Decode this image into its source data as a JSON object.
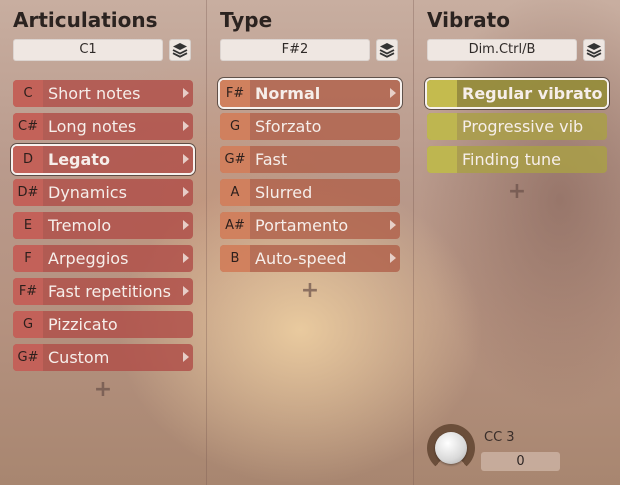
{
  "articulations": {
    "title": "Articulations",
    "selector_value": "C1",
    "items": [
      {
        "key": "C",
        "label": "Short notes",
        "has_arrow": true
      },
      {
        "key": "C#",
        "label": "Long notes",
        "has_arrow": true
      },
      {
        "key": "D",
        "label": "Legato",
        "has_arrow": true,
        "selected": true
      },
      {
        "key": "D#",
        "label": "Dynamics",
        "has_arrow": true
      },
      {
        "key": "E",
        "label": "Tremolo",
        "has_arrow": true
      },
      {
        "key": "F",
        "label": "Arpeggios",
        "has_arrow": true
      },
      {
        "key": "F#",
        "label": "Fast repetitions",
        "has_arrow": true
      },
      {
        "key": "G",
        "label": "Pizzicato",
        "has_arrow": false
      },
      {
        "key": "G#",
        "label": "Custom",
        "has_arrow": true
      }
    ],
    "add_label": "+"
  },
  "type": {
    "title": "Type",
    "selector_value": "F#2",
    "items": [
      {
        "key": "F#",
        "label": "Normal",
        "has_arrow": true,
        "selected": true
      },
      {
        "key": "G",
        "label": "Sforzato",
        "has_arrow": false
      },
      {
        "key": "G#",
        "label": "Fast",
        "has_arrow": false
      },
      {
        "key": "A",
        "label": "Slurred",
        "has_arrow": false
      },
      {
        "key": "A#",
        "label": "Portamento",
        "has_arrow": true
      },
      {
        "key": "B",
        "label": "Auto-speed",
        "has_arrow": true
      }
    ],
    "add_label": "+"
  },
  "vibrato": {
    "title": "Vibrato",
    "selector_value": "Dim.Ctrl/B",
    "items": [
      {
        "key": "",
        "label": "Regular vibrato",
        "selected": true
      },
      {
        "key": "",
        "label": "Progressive vib",
        "selected": false
      },
      {
        "key": "",
        "label": "Finding tune",
        "selected": false
      }
    ],
    "add_label": "+"
  },
  "cc": {
    "label": "CC 3",
    "value": "0"
  },
  "icons": {
    "selector_icon": "layers-icon",
    "arrow_icon": "triangle-right-icon",
    "add_icon": "plus-icon",
    "knob": "knob-icon"
  }
}
